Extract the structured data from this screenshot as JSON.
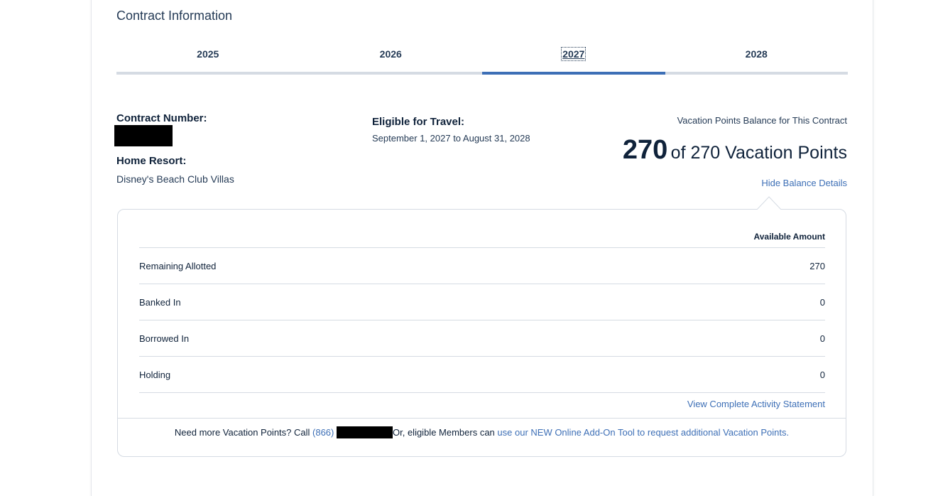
{
  "section": {
    "title": "Contract Information"
  },
  "tabs": [
    {
      "label": "2025"
    },
    {
      "label": "2026"
    },
    {
      "label": "2027"
    },
    {
      "label": "2028"
    }
  ],
  "active_tab": "2027",
  "contract": {
    "number_label": "Contract Number:",
    "home_resort_label": "Home Resort:",
    "home_resort_value": "Disney's Beach Club Villas",
    "eligible_label": "Eligible for Travel:",
    "eligible_value": "September 1, 2027 to August 31, 2028"
  },
  "balance": {
    "title": "Vacation Points Balance for This Contract",
    "current": "270",
    "of_text": "of 270 Vacation Points",
    "hide_link": "Hide Balance Details"
  },
  "details": {
    "column_header": "Available Amount",
    "rows": [
      {
        "label": "Remaining Allotted",
        "value": "270"
      },
      {
        "label": "Banked In",
        "value": "0"
      },
      {
        "label": "Borrowed In",
        "value": "0"
      },
      {
        "label": "Holding",
        "value": "0"
      }
    ],
    "activity_link": "View Complete Activity Statement"
  },
  "footer": {
    "prefix": "Need more Vacation Points? Call ",
    "phone_prefix": "(866)",
    "middle": "Or, eligible Members can ",
    "addon_link": "use our NEW Online Add-On Tool to request additional Vacation Points."
  },
  "colors": {
    "accent": "#3d6fb6",
    "text": "#253b56",
    "border": "#d5dbe3"
  }
}
